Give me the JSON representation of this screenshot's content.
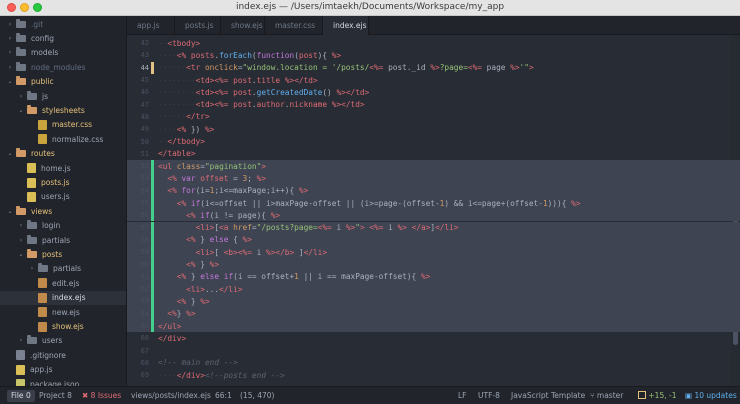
{
  "window": {
    "title": "index.ejs — /Users/imtaekh/Documents/Workspace/my_app"
  },
  "sidebar": {
    "items": [
      {
        "label": ".git",
        "kind": "folder",
        "chev": "›",
        "depth": 1,
        "dim": true
      },
      {
        "label": "config",
        "kind": "folder",
        "chev": "›",
        "depth": 1
      },
      {
        "label": "models",
        "kind": "folder",
        "chev": "›",
        "depth": 1
      },
      {
        "label": "node_modules",
        "kind": "folder",
        "chev": "›",
        "depth": 1,
        "dim": true
      },
      {
        "label": "public",
        "kind": "folder-open",
        "chev": "⌄",
        "depth": 1,
        "status": "mod"
      },
      {
        "label": "js",
        "kind": "folder",
        "chev": "›",
        "depth": 2
      },
      {
        "label": "stylesheets",
        "kind": "folder-open",
        "chev": "⌄",
        "depth": 2,
        "status": "mod"
      },
      {
        "label": "master.css",
        "kind": "css",
        "depth": 3,
        "status": "mod"
      },
      {
        "label": "normalize.css",
        "kind": "css",
        "depth": 3
      },
      {
        "label": "routes",
        "kind": "folder-open",
        "chev": "⌄",
        "depth": 1,
        "status": "mod"
      },
      {
        "label": "home.js",
        "kind": "js",
        "depth": 2
      },
      {
        "label": "posts.js",
        "kind": "js",
        "depth": 2,
        "status": "mod"
      },
      {
        "label": "users.js",
        "kind": "js",
        "depth": 2
      },
      {
        "label": "views",
        "kind": "folder-open",
        "chev": "⌄",
        "depth": 1,
        "status": "mod"
      },
      {
        "label": "login",
        "kind": "folder",
        "chev": "›",
        "depth": 2
      },
      {
        "label": "partials",
        "kind": "folder",
        "chev": "›",
        "depth": 2
      },
      {
        "label": "posts",
        "kind": "folder-open",
        "chev": "⌄",
        "depth": 2,
        "status": "mod"
      },
      {
        "label": "partials",
        "kind": "folder",
        "chev": "›",
        "depth": 3
      },
      {
        "label": "edit.ejs",
        "kind": "ejs",
        "depth": 3
      },
      {
        "label": "index.ejs",
        "kind": "ejs",
        "depth": 3,
        "status": "mod",
        "selected": true
      },
      {
        "label": "new.ejs",
        "kind": "ejs",
        "depth": 3
      },
      {
        "label": "show.ejs",
        "kind": "ejs",
        "depth": 3,
        "status": "mod"
      },
      {
        "label": "users",
        "kind": "folder",
        "chev": "›",
        "depth": 2
      },
      {
        "label": ".gitignore",
        "kind": "plain",
        "depth": 1
      },
      {
        "label": "app.js",
        "kind": "js",
        "depth": 1
      },
      {
        "label": "package.json",
        "kind": "json",
        "depth": 1
      }
    ]
  },
  "tabs": [
    {
      "label": "app.js",
      "active": false
    },
    {
      "label": "posts.js",
      "active": false
    },
    {
      "label": "show.ejs",
      "active": false
    },
    {
      "label": "master.css",
      "active": false
    },
    {
      "label": "index.ejs",
      "active": true
    }
  ],
  "editor": {
    "lines": [
      {
        "n": "42",
        "mark": "",
        "tokens": [
          [
            "ws",
            "··"
          ],
          [
            "tag",
            "<tbody>"
          ]
        ]
      },
      {
        "n": "43",
        "mark": "",
        "tokens": [
          [
            "ws",
            "····"
          ],
          [
            "ejs",
            "<%"
          ],
          [
            "code",
            " "
          ],
          [
            "var",
            "posts"
          ],
          [
            "code",
            "."
          ],
          [
            "fn",
            "forEach"
          ],
          [
            "code",
            "("
          ],
          [
            "kw",
            "function"
          ],
          [
            "code",
            "("
          ],
          [
            "var",
            "post"
          ],
          [
            "code",
            ")"
          ],
          [
            "code",
            "{ "
          ],
          [
            "ejs",
            "%>"
          ]
        ]
      },
      {
        "n": "44",
        "mark": "modified",
        "cur": true,
        "tokens": [
          [
            "ws",
            "······"
          ],
          [
            "tag",
            "<tr"
          ],
          [
            "code",
            " "
          ],
          [
            "attr",
            "onclick"
          ],
          [
            "code",
            "="
          ],
          [
            "str",
            "\"window.location = '/posts/"
          ],
          [
            "ejs",
            "<%="
          ],
          [
            "code",
            " post._id "
          ],
          [
            "ejs",
            "%>"
          ],
          [
            "str",
            "?page="
          ],
          [
            "ejs",
            "<%="
          ],
          [
            "code",
            " page "
          ],
          [
            "ejs",
            "%>"
          ],
          [
            "str",
            "'\""
          ],
          [
            "tag",
            ">"
          ]
        ]
      },
      {
        "n": "45",
        "mark": "",
        "tokens": [
          [
            "ws",
            "········"
          ],
          [
            "tag",
            "<td>"
          ],
          [
            "ejs",
            "<%="
          ],
          [
            "code",
            " "
          ],
          [
            "var",
            "post"
          ],
          [
            "code",
            "."
          ],
          [
            "var",
            "title"
          ],
          [
            "code",
            " "
          ],
          [
            "ejs",
            "%>"
          ],
          [
            "tag",
            "</td>"
          ]
        ]
      },
      {
        "n": "46",
        "mark": "",
        "tokens": [
          [
            "ws",
            "········"
          ],
          [
            "tag",
            "<td>"
          ],
          [
            "ejs",
            "<%="
          ],
          [
            "code",
            " "
          ],
          [
            "var",
            "post"
          ],
          [
            "code",
            "."
          ],
          [
            "fn",
            "getCreatedDate"
          ],
          [
            "code",
            "() "
          ],
          [
            "ejs",
            "%>"
          ],
          [
            "tag",
            "</td>"
          ]
        ]
      },
      {
        "n": "47",
        "mark": "",
        "tokens": [
          [
            "ws",
            "········"
          ],
          [
            "tag",
            "<td>"
          ],
          [
            "ejs",
            "<%="
          ],
          [
            "code",
            " "
          ],
          [
            "var",
            "post"
          ],
          [
            "code",
            "."
          ],
          [
            "var",
            "author"
          ],
          [
            "code",
            "."
          ],
          [
            "var",
            "nickname"
          ],
          [
            "code",
            " "
          ],
          [
            "ejs",
            "%>"
          ],
          [
            "tag",
            "</td>"
          ]
        ]
      },
      {
        "n": "48",
        "mark": "",
        "tokens": [
          [
            "ws",
            "······"
          ],
          [
            "tag",
            "</tr>"
          ]
        ]
      },
      {
        "n": "49",
        "mark": "",
        "tokens": [
          [
            "ws",
            "····"
          ],
          [
            "ejs",
            "<%"
          ],
          [
            "code",
            " }) "
          ],
          [
            "ejs",
            "%>"
          ]
        ]
      },
      {
        "n": "50",
        "mark": "",
        "tokens": [
          [
            "ws",
            "··"
          ],
          [
            "tag",
            "</tbody>"
          ]
        ]
      },
      {
        "n": "51",
        "mark": "",
        "tokens": [
          [
            "tag",
            "</table>"
          ]
        ]
      },
      {
        "n": "52",
        "mark": "added",
        "sel": true,
        "tokens": [
          [
            "tag",
            "<ul"
          ],
          [
            "code",
            " "
          ],
          [
            "attr",
            "class"
          ],
          [
            "code",
            "="
          ],
          [
            "str",
            "\"pagination\""
          ],
          [
            "tag",
            ">"
          ]
        ]
      },
      {
        "n": "53",
        "mark": "added",
        "sel": true,
        "tokens": [
          [
            "ws",
            "··"
          ],
          [
            "ejs",
            "<%"
          ],
          [
            "code",
            " "
          ],
          [
            "kw",
            "var"
          ],
          [
            "code",
            " "
          ],
          [
            "var",
            "offset"
          ],
          [
            "code",
            " = "
          ],
          [
            "num",
            "3"
          ],
          [
            "code",
            "; "
          ],
          [
            "ejs",
            "%>"
          ]
        ]
      },
      {
        "n": "54",
        "mark": "added",
        "sel": true,
        "tokens": [
          [
            "ws",
            "··"
          ],
          [
            "ejs",
            "<%"
          ],
          [
            "code",
            " "
          ],
          [
            "kw",
            "for"
          ],
          [
            "code",
            "(i="
          ],
          [
            "num",
            "1"
          ],
          [
            "code",
            ";i<=maxPage;i++){ "
          ],
          [
            "ejs",
            "%>"
          ]
        ]
      },
      {
        "n": "55",
        "mark": "added",
        "sel": true,
        "tokens": [
          [
            "ws",
            "····"
          ],
          [
            "ejs",
            "<%"
          ],
          [
            "code",
            " "
          ],
          [
            "kw",
            "if"
          ],
          [
            "code",
            "(i<=offset || i>maxPage-offset || (i>=page-(offset-"
          ],
          [
            "num",
            "1"
          ],
          [
            "code",
            ") && i<=page+(offset-"
          ],
          [
            "num",
            "1"
          ],
          [
            "code",
            "))){ "
          ],
          [
            "ejs",
            "%>"
          ]
        ]
      },
      {
        "n": "56",
        "mark": "added",
        "sel": true,
        "tokens": [
          [
            "ws",
            "······"
          ],
          [
            "ejs",
            "<%"
          ],
          [
            "code",
            " "
          ],
          [
            "kw",
            "if"
          ],
          [
            "code",
            "(i != page){ "
          ],
          [
            "ejs",
            "%>"
          ]
        ]
      },
      {
        "n": "57",
        "mark": "added",
        "sel": true,
        "tokens": [
          [
            "ws",
            "········"
          ],
          [
            "tag",
            "<li>"
          ],
          [
            "code",
            "["
          ],
          [
            "tag",
            "<a"
          ],
          [
            "code",
            " "
          ],
          [
            "attr",
            "href"
          ],
          [
            "code",
            "="
          ],
          [
            "str",
            "\"/posts?page="
          ],
          [
            "ejs",
            "<%="
          ],
          [
            "code",
            " i "
          ],
          [
            "ejs",
            "%>"
          ],
          [
            "str",
            "\""
          ],
          [
            "tag",
            ">"
          ],
          [
            "code",
            " "
          ],
          [
            "ejs",
            "<%="
          ],
          [
            "code",
            " i "
          ],
          [
            "ejs",
            "%>"
          ],
          [
            "code",
            " "
          ],
          [
            "tag",
            "</a>"
          ],
          [
            "code",
            "]"
          ],
          [
            "tag",
            "</li>"
          ]
        ]
      },
      {
        "n": "58",
        "mark": "added",
        "sel": true,
        "tokens": [
          [
            "ws",
            "······"
          ],
          [
            "ejs",
            "<%"
          ],
          [
            "code",
            " } "
          ],
          [
            "kw",
            "else"
          ],
          [
            "code",
            " { "
          ],
          [
            "ejs",
            "%>"
          ]
        ]
      },
      {
        "n": "59",
        "mark": "added",
        "sel": true,
        "tokens": [
          [
            "ws",
            "········"
          ],
          [
            "tag",
            "<li>"
          ],
          [
            "code",
            "[ "
          ],
          [
            "tag",
            "<b>"
          ],
          [
            "ejs",
            "<%="
          ],
          [
            "code",
            " i "
          ],
          [
            "ejs",
            "%>"
          ],
          [
            "tag",
            "</b>"
          ],
          [
            "code",
            " ]"
          ],
          [
            "tag",
            "</li>"
          ]
        ]
      },
      {
        "n": "60",
        "mark": "added",
        "sel": true,
        "tokens": [
          [
            "ws",
            "······"
          ],
          [
            "ejs",
            "<%"
          ],
          [
            "code",
            " } "
          ],
          [
            "ejs",
            "%>"
          ]
        ]
      },
      {
        "n": "61",
        "mark": "added",
        "sel": true,
        "tokens": [
          [
            "ws",
            "····"
          ],
          [
            "ejs",
            "<%"
          ],
          [
            "code",
            " } "
          ],
          [
            "kw",
            "else"
          ],
          [
            "code",
            " "
          ],
          [
            "kw",
            "if"
          ],
          [
            "code",
            "(i == offset+"
          ],
          [
            "num",
            "1"
          ],
          [
            "code",
            " || i == maxPage-offset){ "
          ],
          [
            "ejs",
            "%>"
          ]
        ]
      },
      {
        "n": "62",
        "mark": "added",
        "sel": true,
        "tokens": [
          [
            "ws",
            "······"
          ],
          [
            "tag",
            "<li>"
          ],
          [
            "code",
            "..."
          ],
          [
            "tag",
            "</li>"
          ]
        ]
      },
      {
        "n": "63",
        "mark": "added",
        "sel": true,
        "tokens": [
          [
            "ws",
            "····"
          ],
          [
            "ejs",
            "<%"
          ],
          [
            "code",
            " } "
          ],
          [
            "ejs",
            "%>"
          ]
        ]
      },
      {
        "n": "64",
        "mark": "added",
        "sel": true,
        "tokens": [
          [
            "ws",
            "··"
          ],
          [
            "ejs",
            "<%"
          ],
          [
            "code",
            "} "
          ],
          [
            "ejs",
            "%>"
          ]
        ]
      },
      {
        "n": "65",
        "mark": "added",
        "sel": true,
        "tokens": [
          [
            "tag",
            "</ul>"
          ]
        ]
      },
      {
        "n": "66",
        "mark": "",
        "tokens": [
          [
            "tag",
            "</div>"
          ]
        ]
      },
      {
        "n": "67",
        "mark": "",
        "tokens": []
      },
      {
        "n": "68",
        "mark": "",
        "tokens": [
          [
            "cmt",
            "<!-- main end -->"
          ]
        ]
      },
      {
        "n": "69",
        "mark": "",
        "tokens": [
          [
            "ws",
            "····"
          ],
          [
            "tag",
            "</div>"
          ],
          [
            "cmt",
            "<!--posts end -->"
          ]
        ]
      }
    ]
  },
  "status": {
    "file_label": "File",
    "file_count": "0",
    "project_label": "Project",
    "project_count": "8",
    "issues": "8 Issues",
    "path": "views/posts/index.ejs",
    "cursor": "66:1",
    "selection": "(15, 470)",
    "line_ending": "LF",
    "encoding": "UTF-8",
    "grammar": "JavaScript Template",
    "branch": "master",
    "diff": "+15, -1",
    "updates": "10 updates"
  },
  "colors": {
    "editor_bg": "#282c34",
    "sidebar_bg": "#21252b",
    "added_marker": "#43d08a",
    "modified_marker": "#e0c285",
    "selection": "#3e4451"
  }
}
